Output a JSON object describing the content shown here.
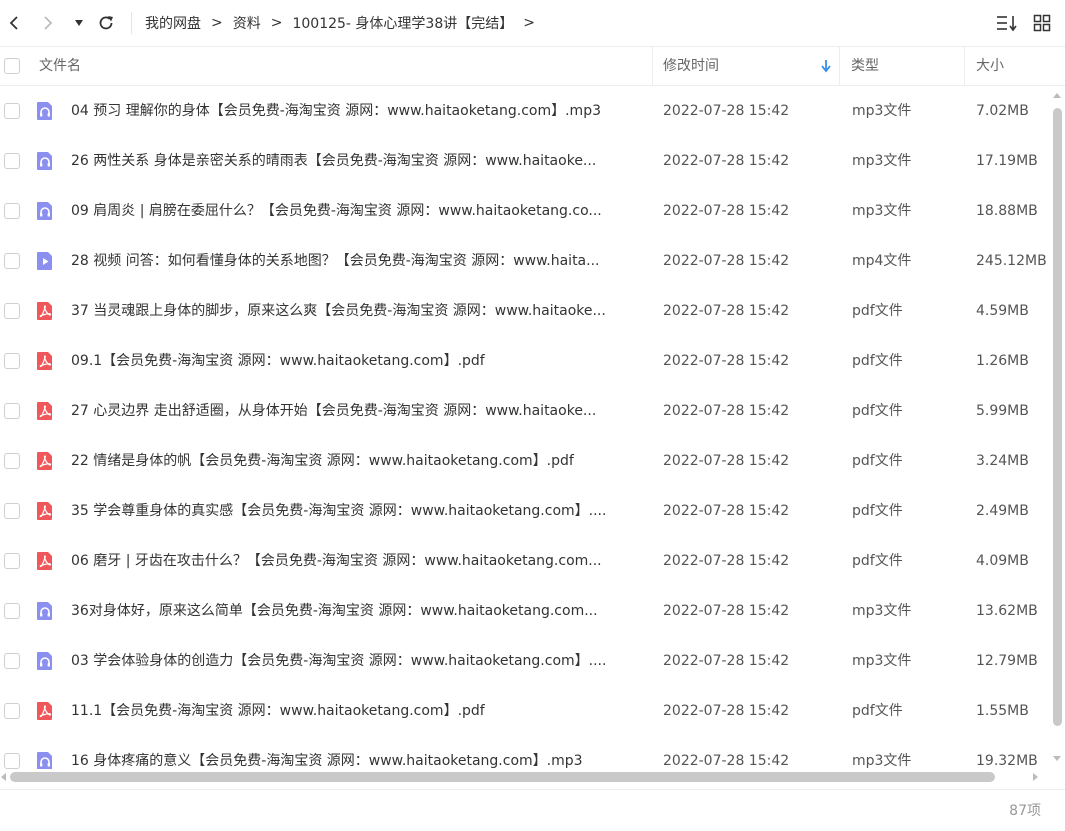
{
  "breadcrumb": {
    "root": "我的网盘",
    "level1": "资料",
    "current": "100125- 身体心理学38讲【完结】"
  },
  "columns": {
    "name": "文件名",
    "modified": "修改时间",
    "type": "类型",
    "size": "大小"
  },
  "sort": {
    "column": "modified",
    "direction": "descending"
  },
  "colors": {
    "audio_icon": "#8b8ff0",
    "video_icon": "#8b8ff0",
    "pdf_icon": "#f0575b",
    "sort_arrow": "#3a8ee6"
  },
  "files": [
    {
      "name": "04 预习  理解你的身体【会员免费-海淘宝资 源网：www.haitaoketang.com】.mp3",
      "modified": "2022-07-28 15:42",
      "type": "mp3文件",
      "size": "7.02MB",
      "icon": "audio-icon"
    },
    {
      "name": "26 两性关系  身体是亲密关系的晴雨表【会员免费-海淘宝资 源网：www.haitaoke...",
      "modified": "2022-07-28 15:42",
      "type": "mp3文件",
      "size": "17.19MB",
      "icon": "audio-icon"
    },
    {
      "name": "09 肩周炎 | 肩膀在委屈什么？【会员免费-海淘宝资 源网：www.haitaoketang.co...",
      "modified": "2022-07-28 15:42",
      "type": "mp3文件",
      "size": "18.88MB",
      "icon": "audio-icon"
    },
    {
      "name": "28 视频 问答：如何看懂身体的关系地图？【会员免费-海淘宝资 源网：www.haita...",
      "modified": "2022-07-28 15:42",
      "type": "mp4文件",
      "size": "245.12MB",
      "icon": "video-icon"
    },
    {
      "name": "37 当灵魂跟上身体的脚步，原来这么爽【会员免费-海淘宝资 源网：www.haitaoke...",
      "modified": "2022-07-28 15:42",
      "type": "pdf文件",
      "size": "4.59MB",
      "icon": "pdf-icon"
    },
    {
      "name": "09.1【会员免费-海淘宝资 源网：www.haitaoketang.com】.pdf",
      "modified": "2022-07-28 15:42",
      "type": "pdf文件",
      "size": "1.26MB",
      "icon": "pdf-icon"
    },
    {
      "name": "27 心灵边界  走出舒适圈，从身体开始【会员免费-海淘宝资 源网：www.haitaoke...",
      "modified": "2022-07-28 15:42",
      "type": "pdf文件",
      "size": "5.99MB",
      "icon": "pdf-icon"
    },
    {
      "name": "22 情绪是身体的帆【会员免费-海淘宝资 源网：www.haitaoketang.com】.pdf",
      "modified": "2022-07-28 15:42",
      "type": "pdf文件",
      "size": "3.24MB",
      "icon": "pdf-icon"
    },
    {
      "name": "35 学会尊重身体的真实感【会员免费-海淘宝资 源网：www.haitaoketang.com】....",
      "modified": "2022-07-28 15:42",
      "type": "pdf文件",
      "size": "2.49MB",
      "icon": "pdf-icon"
    },
    {
      "name": "06 磨牙 | 牙齿在攻击什么？【会员免费-海淘宝资 源网：www.haitaoketang.com...",
      "modified": "2022-07-28 15:42",
      "type": "pdf文件",
      "size": "4.09MB",
      "icon": "pdf-icon"
    },
    {
      "name": "36对身体好，原来这么简单【会员免费-海淘宝资 源网：www.haitaoketang.com...",
      "modified": "2022-07-28 15:42",
      "type": "mp3文件",
      "size": "13.62MB",
      "icon": "audio-icon"
    },
    {
      "name": "03 学会体验身体的创造力【会员免费-海淘宝资 源网：www.haitaoketang.com】....",
      "modified": "2022-07-28 15:42",
      "type": "mp3文件",
      "size": "12.79MB",
      "icon": "audio-icon"
    },
    {
      "name": "11.1【会员免费-海淘宝资 源网：www.haitaoketang.com】.pdf",
      "modified": "2022-07-28 15:42",
      "type": "pdf文件",
      "size": "1.55MB",
      "icon": "pdf-icon"
    },
    {
      "name": "16 身体疼痛的意义【会员免费-海淘宝资 源网：www.haitaoketang.com】.mp3",
      "modified": "2022-07-28 15:42",
      "type": "mp3文件",
      "size": "19.32MB",
      "icon": "audio-icon"
    }
  ],
  "footer": {
    "count": "87项"
  }
}
